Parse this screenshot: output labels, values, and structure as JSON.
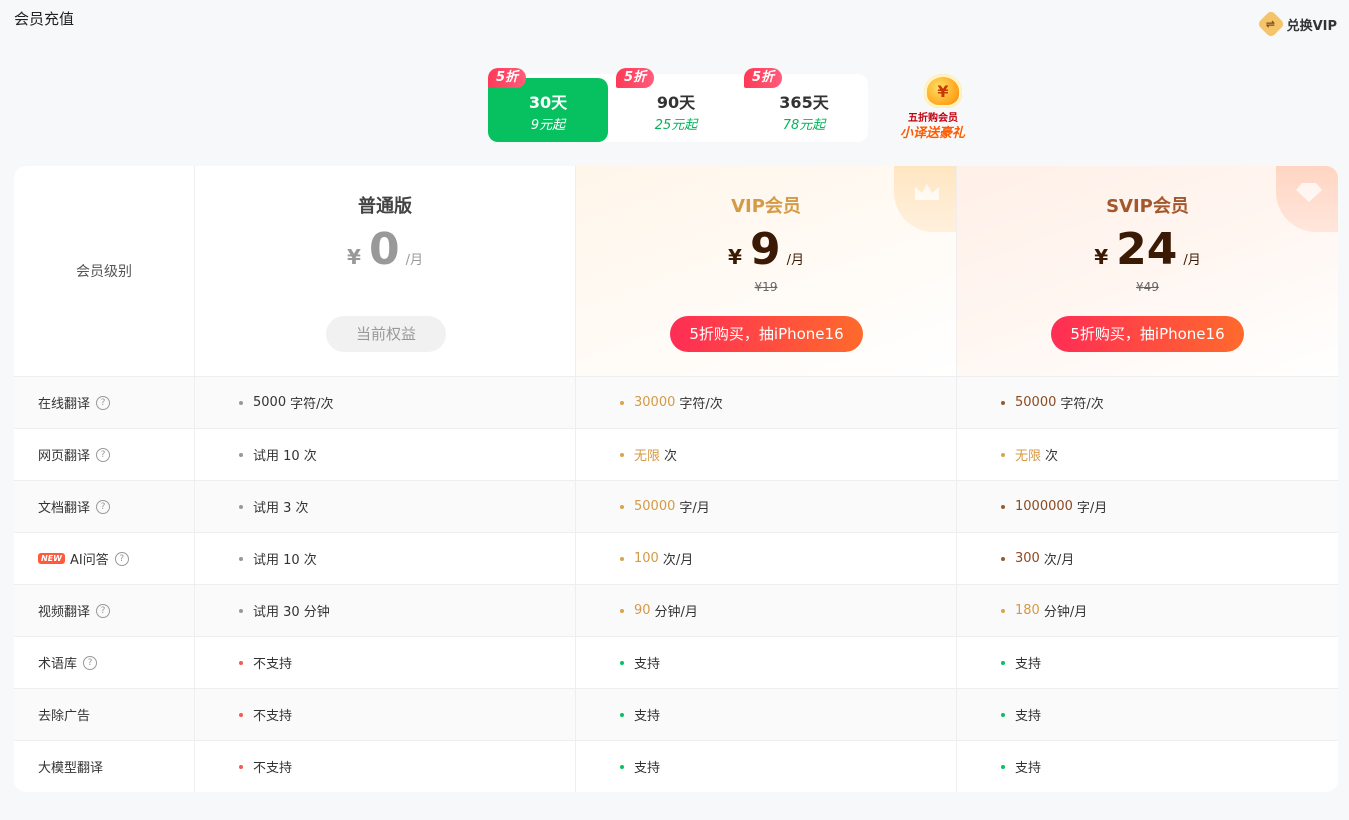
{
  "header": {
    "title": "会员充值",
    "redeem_label": "兑换VIP",
    "redeem_icon": "exchange-icon"
  },
  "plans": [
    {
      "badge": "5折",
      "days": "30天",
      "price": "9元起",
      "active": true
    },
    {
      "badge": "5折",
      "days": "90天",
      "price": "25元起",
      "active": false
    },
    {
      "badge": "5折",
      "days": "365天",
      "price": "78元起",
      "active": false
    }
  ],
  "promo": {
    "line1": "五折购会员",
    "line2": "小译送豪礼"
  },
  "compare": {
    "label_header": "会员级别",
    "tiers": [
      {
        "name": "普通版",
        "currency": "¥",
        "amount": "0",
        "unit": "/月",
        "original": "",
        "button": "当前权益"
      },
      {
        "name": "VIP会员",
        "currency": "¥",
        "amount": "9",
        "unit": "/月",
        "original": "¥19",
        "button": "5折购买，抽iPhone16"
      },
      {
        "name": "SVIP会员",
        "currency": "¥",
        "amount": "24",
        "unit": "/月",
        "original": "¥49",
        "button": "5折购买，抽iPhone16"
      }
    ],
    "rows": [
      {
        "label": "在线翻译",
        "help": true,
        "basic": [
          "5000",
          "字符/次"
        ],
        "vip": [
          "30000",
          "字符/次"
        ],
        "svip": [
          "50000",
          "字符/次"
        ]
      },
      {
        "label": "网页翻译",
        "help": true,
        "basic": [
          "试用 10 次",
          ""
        ],
        "vip": [
          "无限",
          "次"
        ],
        "svip": [
          "无限",
          "次"
        ]
      },
      {
        "label": "文档翻译",
        "help": true,
        "basic": [
          "试用 3 次",
          ""
        ],
        "vip": [
          "50000",
          "字/月"
        ],
        "svip": [
          "1000000",
          "字/月"
        ]
      },
      {
        "label": "AI问答",
        "new": "NEW",
        "help": true,
        "basic": [
          "试用 10 次",
          ""
        ],
        "vip": [
          "100",
          "次/月"
        ],
        "svip": [
          "300",
          "次/月"
        ]
      },
      {
        "label": "视频翻译",
        "help": true,
        "basic": [
          "试用 30 分钟",
          ""
        ],
        "vip": [
          "90",
          "分钟/月"
        ],
        "svip": [
          "180",
          "分钟/月"
        ]
      },
      {
        "label": "术语库",
        "help": true,
        "basic": [
          "不支持",
          ""
        ],
        "vip": [
          "支持",
          ""
        ],
        "svip": [
          "支持",
          ""
        ]
      },
      {
        "label": "去除广告",
        "help": false,
        "basic": [
          "不支持",
          ""
        ],
        "vip": [
          "支持",
          ""
        ],
        "svip": [
          "支持",
          ""
        ]
      },
      {
        "label": "大模型翻译",
        "help": false,
        "basic": [
          "不支持",
          ""
        ],
        "vip": [
          "支持",
          ""
        ],
        "svip": [
          "支持",
          ""
        ]
      }
    ]
  },
  "colors": {
    "accent_green": "#07c160",
    "vip_gold": "#d49a45",
    "svip_brown": "#a4562c",
    "cta_start": "#ff2d55",
    "cta_end": "#ff6a2c"
  }
}
